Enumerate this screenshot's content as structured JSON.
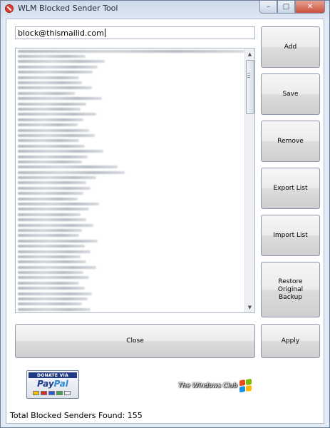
{
  "window": {
    "title": "WLM Blocked Sender Tool",
    "controls": {
      "minimize": "–",
      "maximize": "□",
      "close": "✕"
    }
  },
  "input": {
    "value": "block@thismailid.com"
  },
  "list": {
    "item_count_visible": 51,
    "note": ""
  },
  "buttons": {
    "add": "Add",
    "save": "Save",
    "remove": "Remove",
    "export": "Export List",
    "import": "Import List",
    "restore": "Restore Original Backup",
    "close": "Close",
    "apply": "Apply"
  },
  "paypal": {
    "top": "DONATE VIA",
    "logo_a": "Pay",
    "logo_b": "Pal"
  },
  "branding": {
    "text": "The Windows Club"
  },
  "status": {
    "text": "Total Blocked Senders Found: 155"
  },
  "colors": {
    "window_frame": "#cfdbea",
    "close_button": "#c9503b"
  }
}
